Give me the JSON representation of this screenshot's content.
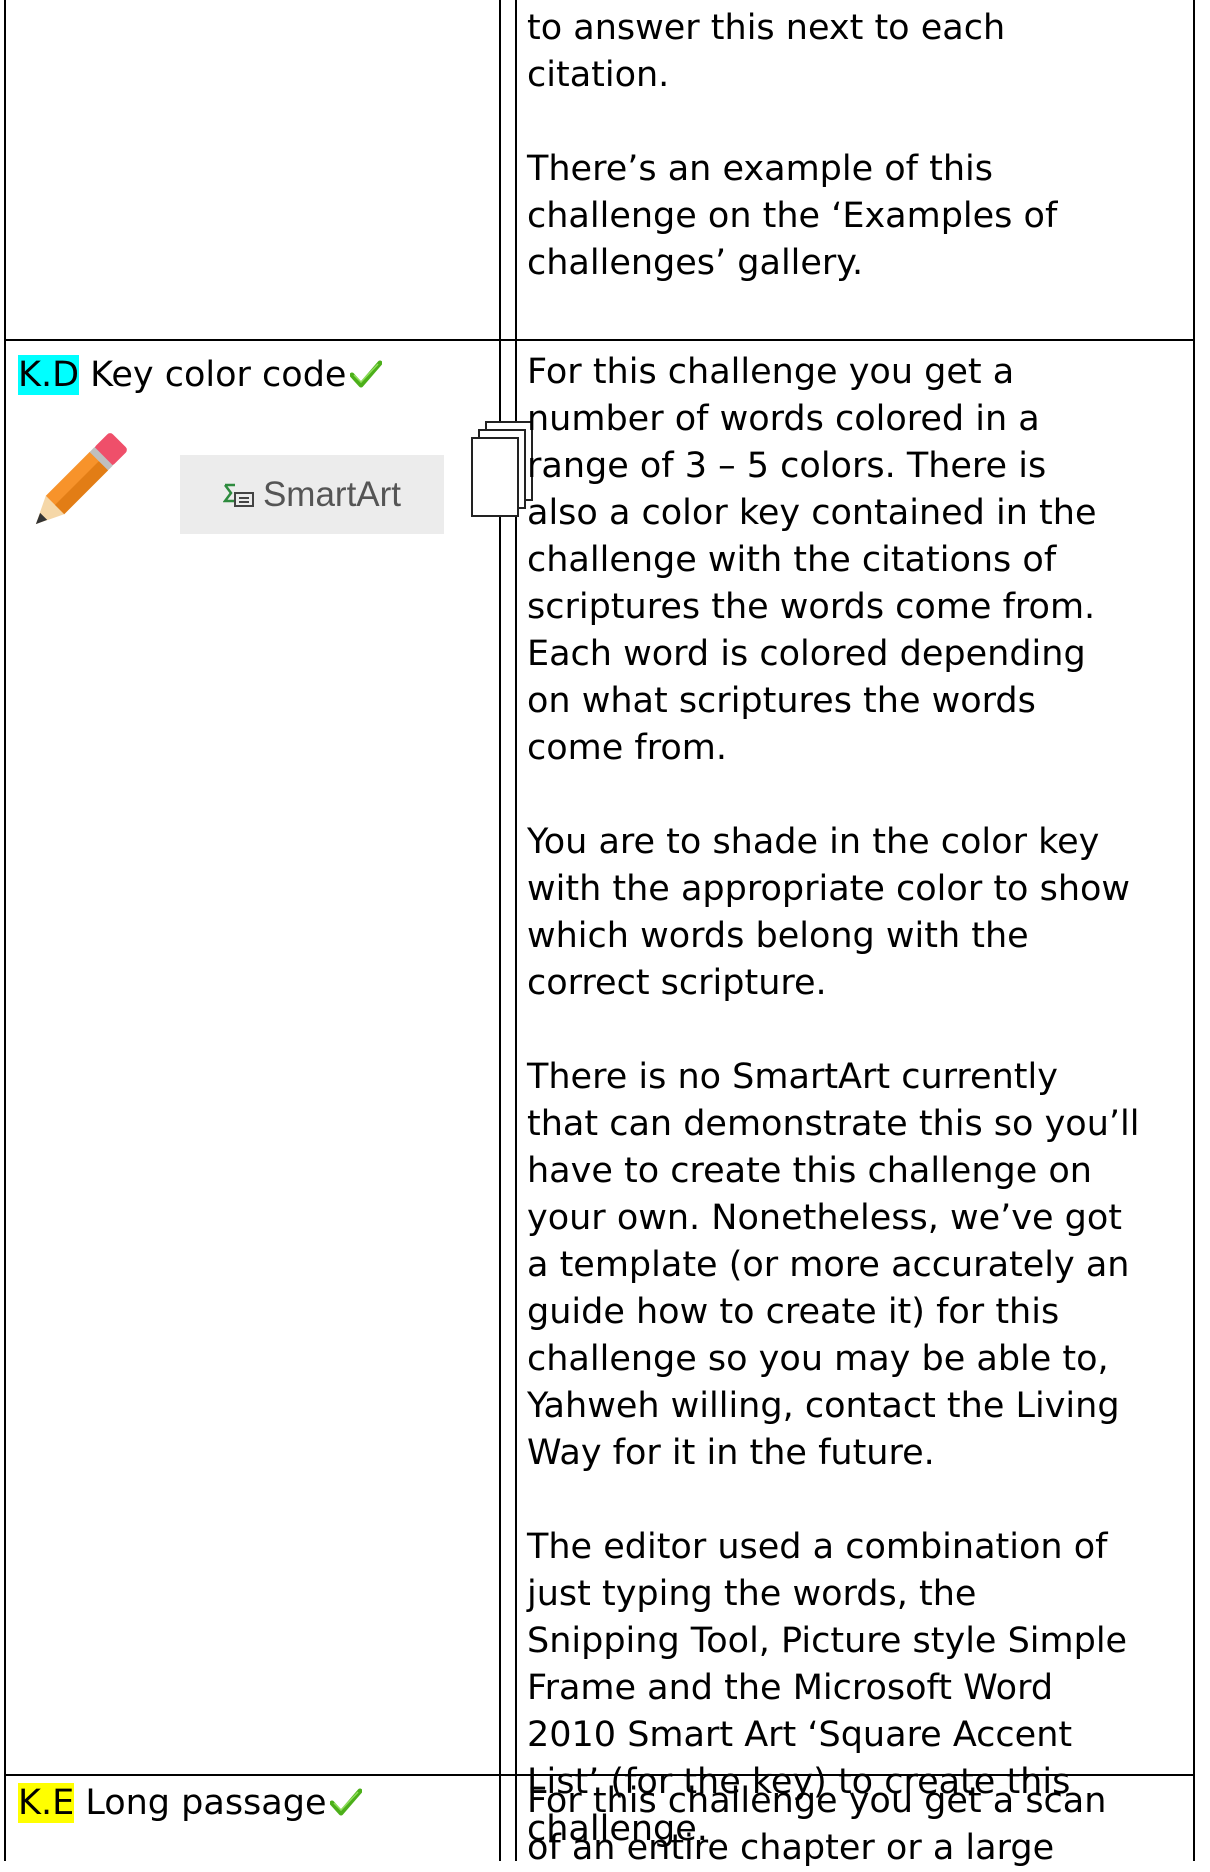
{
  "row1": {
    "right_lines": [
      "to answer this next to each",
      "citation."
    ],
    "right_para2": [
      "There’s an example of this",
      "challenge on the ‘Examples of",
      "challenges’ gallery."
    ]
  },
  "row_kd": {
    "code": "K.D",
    "title": " Key color code",
    "smartart_label": "SmartArt",
    "icons": [
      "pencil-icon",
      "smartart-icon",
      "stacked-pages-icon"
    ],
    "paragraphs": [
      [
        "For this challenge you get a",
        "number of words colored in a",
        "range of 3 – 5 colors. There is",
        "also a color key contained in the",
        "challenge with the citations of",
        "scriptures the words come from.",
        "Each word is colored depending",
        "on what scriptures the words",
        "come from."
      ],
      [
        "You are to shade in the color key",
        "with the appropriate color to show",
        "which words belong with the",
        "correct scripture."
      ],
      [
        "There is no SmartArt currently",
        "that can demonstrate this so you’ll",
        "have to create this challenge on",
        "your own. Nonetheless, we’ve got",
        "a template (or more accurately an",
        "guide how to create it) for this",
        "challenge so you may be able to,",
        "Yahweh willing, contact the Living",
        "Way for it in the future."
      ],
      [
        "The editor used a combination of",
        "just typing the words, the",
        "Snipping Tool, Picture style Simple",
        "Frame and the Microsoft Word",
        "2010 Smart Art ‘Square Accent",
        "List’ (for the key) to create this",
        "challenge."
      ]
    ]
  },
  "row_ke": {
    "code": "K.E",
    "title": " Long passage",
    "right_lines": [
      "For this challenge you get a scan",
      "of an entire chapter or a large"
    ]
  },
  "colors": {
    "highlight_cyan": "#00ffff",
    "highlight_yellow": "#ffff00",
    "check_green": "#4caf1a",
    "pencil_orange": "#f7932b",
    "pencil_eraser": "#ef4f6a"
  }
}
